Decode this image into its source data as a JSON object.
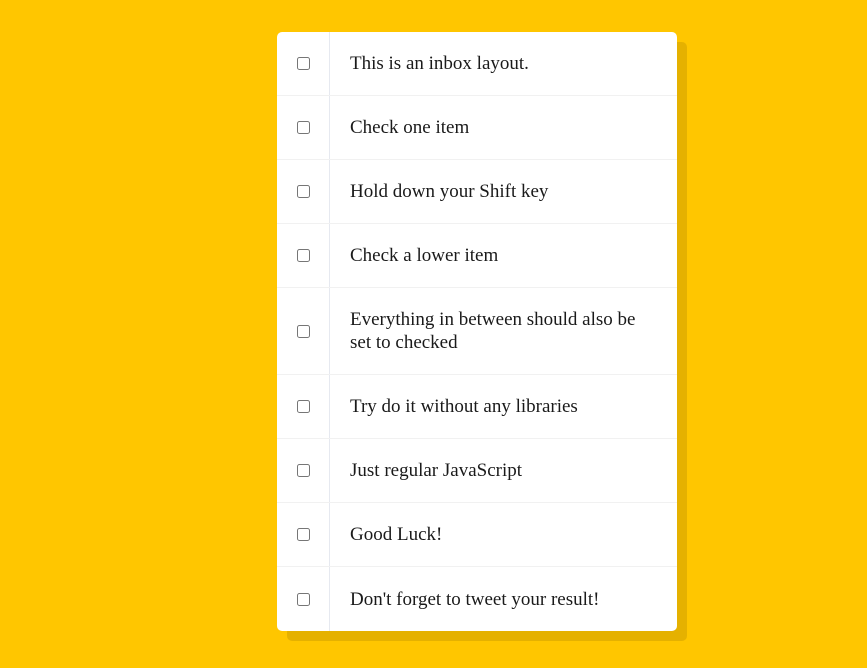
{
  "inbox": {
    "items": [
      {
        "label": "This is an inbox layout.",
        "checked": false
      },
      {
        "label": "Check one item",
        "checked": false
      },
      {
        "label": "Hold down your Shift key",
        "checked": false
      },
      {
        "label": "Check a lower item",
        "checked": false
      },
      {
        "label": "Everything in between should also be set to checked",
        "checked": false
      },
      {
        "label": "Try do it without any libraries",
        "checked": false
      },
      {
        "label": "Just regular JavaScript",
        "checked": false
      },
      {
        "label": "Good Luck!",
        "checked": false
      },
      {
        "label": "Don't forget to tweet your result!",
        "checked": false
      }
    ]
  },
  "colors": {
    "background": "#ffc600",
    "card": "#ffffff",
    "text": "#1a1a1a",
    "divider": "#f1f1f1"
  }
}
